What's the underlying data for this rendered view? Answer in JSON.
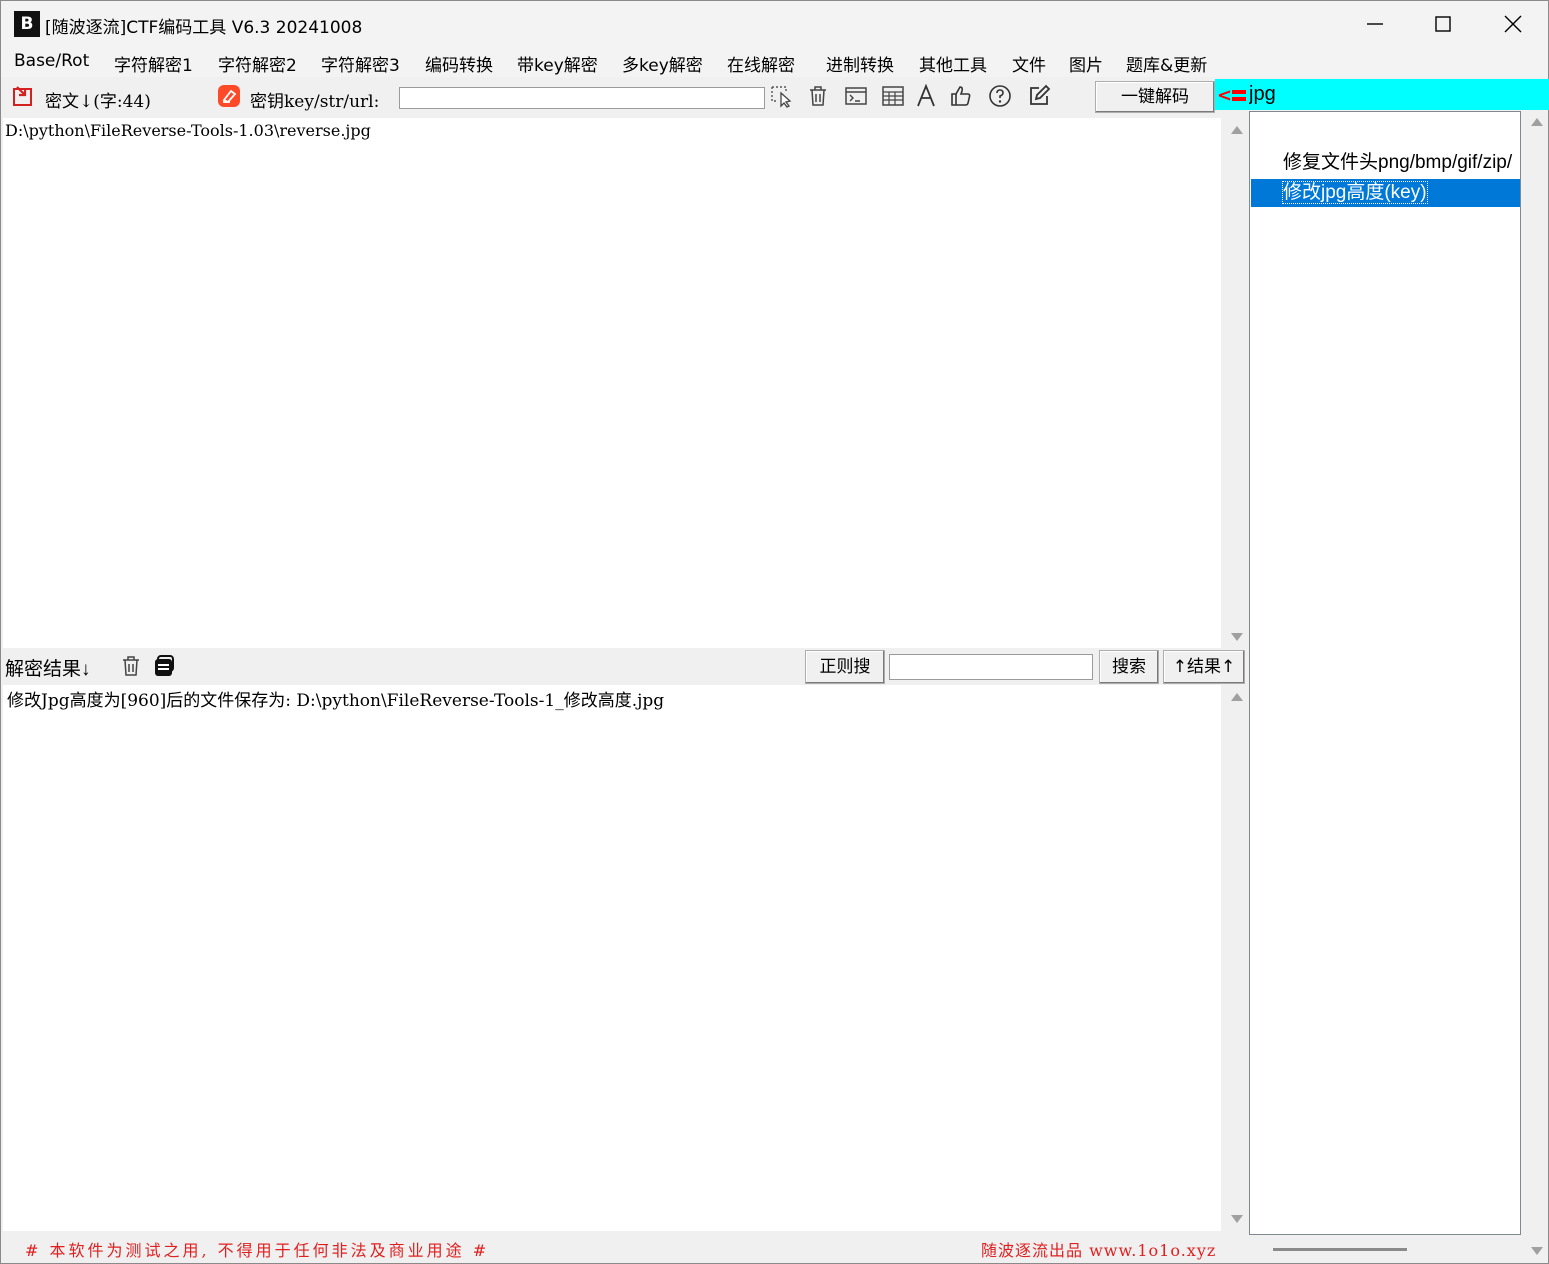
{
  "window": {
    "title": "[随波逐流]CTF编码工具 V6.3 20241008",
    "icon_text": "B"
  },
  "menu": [
    "Base/Rot",
    "字符解密1",
    "字符解密2",
    "字符解密3",
    "编码转换",
    "带key解密",
    "多key解密",
    "在线解密",
    "进制转换",
    "其他工具",
    "文件",
    "图片",
    "题库&更新"
  ],
  "toolbar": {
    "cipher_label": "密文↓(字:44)",
    "key_label": "密钥key/str/url:",
    "key_value": "",
    "decode_button": "一键解码",
    "filter_arrow": "<",
    "filter_value": "jpg"
  },
  "cipher_text": "D:\\python\\FileReverse-Tools-1.03\\reverse.jpg",
  "result_bar": {
    "label": "解密结果↓",
    "regex_button": "正则搜",
    "search_value": "",
    "search_button": "搜索",
    "result_up_button": "↑结果↑"
  },
  "result_text": "修改Jpg高度为[960]后的文件保存为: D:\\python\\FileReverse-Tools-1_修改高度.jpg",
  "list": {
    "items": [
      "修复文件头png/bmp/gif/zip/",
      "修改jpg高度(key)"
    ],
    "selected_index": 1
  },
  "footer": {
    "left": "# 本软件为测试之用, 不得用于任何非法及商业用途 #",
    "right": "随波逐流出品 www.1o1o.xyz"
  },
  "colors": {
    "accent": "#0078d7",
    "filter_bg": "#00ffff",
    "footer_text": "#e02020",
    "key_icon": "#ff4a2a"
  },
  "icons": [
    "app-logo-icon",
    "minimize-icon",
    "maximize-icon",
    "close-icon",
    "import-icon",
    "eraser-icon",
    "select-icon",
    "trash-icon",
    "terminal-icon",
    "table-icon",
    "font-icon",
    "thumbs-up-icon",
    "help-icon",
    "edit-icon",
    "copy-icon"
  ]
}
